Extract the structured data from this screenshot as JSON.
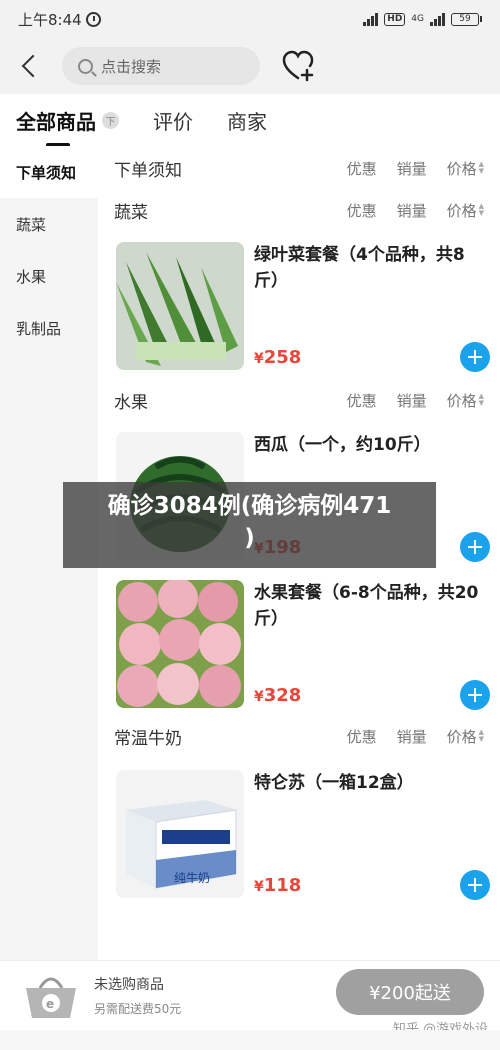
{
  "status": {
    "time": "上午8:44",
    "net": "4G",
    "hd": "HD",
    "battery": "59"
  },
  "header": {
    "search_placeholder": "点击搜索"
  },
  "tabs": [
    {
      "label": "全部商品"
    },
    {
      "label": "评价"
    },
    {
      "label": "商家"
    }
  ],
  "tab_pin": "下",
  "sidebar": {
    "items": [
      {
        "label": "下单须知"
      },
      {
        "label": "蔬菜"
      },
      {
        "label": "水果"
      },
      {
        "label": "乳制品"
      }
    ]
  },
  "sort": {
    "discount": "优惠",
    "sales": "销量",
    "price": "价格"
  },
  "sections": [
    {
      "title": "下单须知"
    },
    {
      "title": "蔬菜"
    },
    {
      "title": "水果"
    },
    {
      "title": "常温牛奶"
    }
  ],
  "products": [
    {
      "name": "绿叶菜套餐（4个品种，共8斤）",
      "currency": "¥",
      "price": "258",
      "image": "leafy-greens"
    },
    {
      "name": "西瓜（一个，约10斤）",
      "currency": "¥",
      "price": "198",
      "image": "watermelon"
    },
    {
      "name": "水果套餐（6-8个品种，共20斤）",
      "currency": "¥",
      "price": "328",
      "image": "peaches"
    },
    {
      "name": "特仑苏（一箱12盒）",
      "currency": "¥",
      "price": "118",
      "image": "milk-box"
    }
  ],
  "milk_box_text": "纯牛奶",
  "overlay": {
    "line1": "确诊3084例(确诊病例471",
    "line2": ")"
  },
  "cart": {
    "empty": "未选购商品",
    "fee": "另需配送费50元",
    "checkout": "¥200起送"
  },
  "watermark": "知乎 @游戏外设"
}
